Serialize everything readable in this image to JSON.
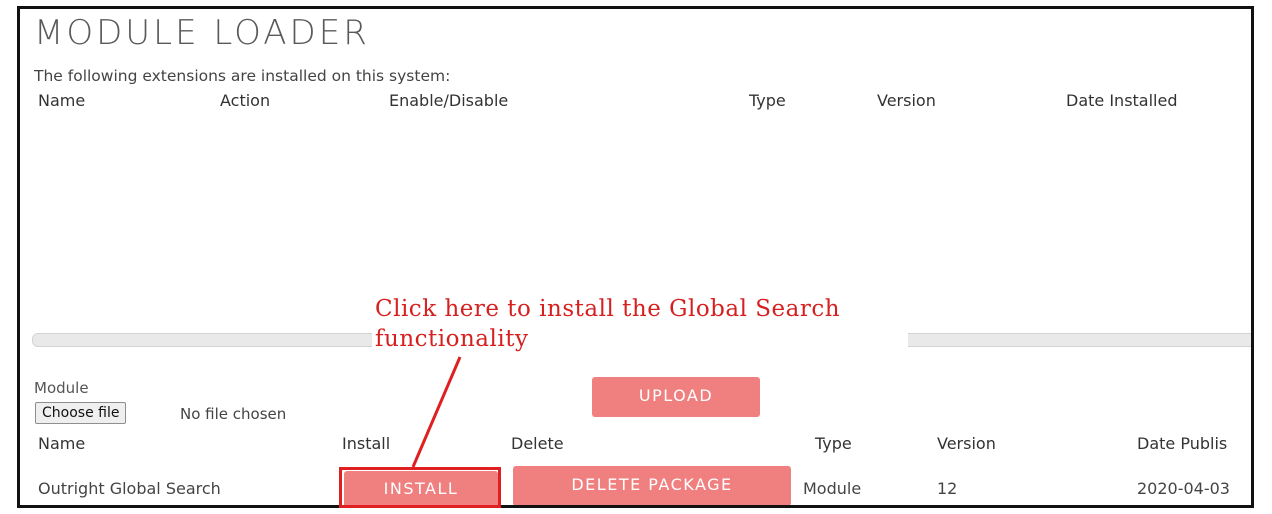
{
  "page": {
    "title": "MODULE LOADER",
    "subtitle": "The following extensions are installed on this system:"
  },
  "installed_table": {
    "headers": [
      "Name",
      "Action",
      "Enable/Disable",
      "Type",
      "Version",
      "Date Installed"
    ],
    "rows": []
  },
  "upload_form": {
    "module_label": "Module",
    "choose_file_label": "Choose file",
    "no_file_text": "No file chosen",
    "upload_label": "UPLOAD"
  },
  "packages_table": {
    "headers": [
      "Name",
      "Install",
      "Delete",
      "Type",
      "Version",
      "Date Publis"
    ],
    "rows": [
      {
        "name": "Outright Global Search",
        "install_label": "INSTALL",
        "delete_label": "DELETE PACKAGE",
        "type": "Module",
        "version": "12",
        "date_published": "2020-04-03"
      }
    ]
  },
  "annotation": {
    "text": "Click here to install the Global Search functionality",
    "color": "#d62020"
  },
  "colors": {
    "button": "#f08080",
    "highlight": "#e02020"
  }
}
